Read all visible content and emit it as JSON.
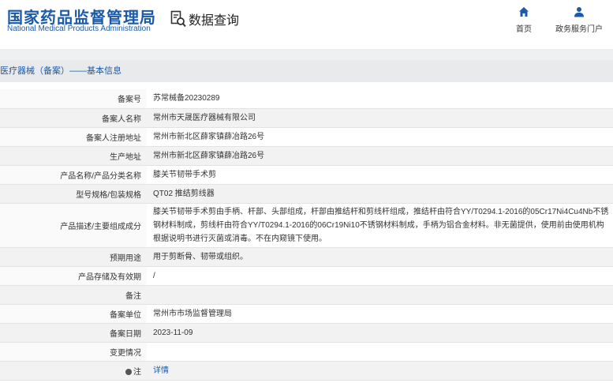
{
  "header": {
    "logo_cn": "国家药品监督管理局",
    "logo_en": "National Medical Products Administration",
    "query_label": "数据查询",
    "nav": [
      {
        "label": "首页",
        "icon": "home-icon"
      },
      {
        "label": "政务服务门户",
        "icon": "user-icon"
      }
    ],
    "brand_color": "#1c5aa8"
  },
  "breadcrumb": "医疗器械（备案）——基本信息",
  "detail": {
    "rows": [
      {
        "key": "备案号",
        "value": "苏常械备20230289"
      },
      {
        "key": "备案人名称",
        "value": "常州市天晟医疗器械有限公司"
      },
      {
        "key": "备案人注册地址",
        "value": "常州市新北区薛家镇薛冶路26号"
      },
      {
        "key": "生产地址",
        "value": "常州市新北区薛家镇薛冶路26号"
      },
      {
        "key": "产品名称/产品分类名称",
        "value": "膝关节韧带手术剪"
      },
      {
        "key": "型号规格/包装规格",
        "value": "QT02 推结剪线器"
      },
      {
        "key": "产品描述/主要组成成分",
        "value": "膝关节韧带手术剪由手柄、杆部、头部组成，杆部由推结杆和剪线杆组成，推结杆由符合YY/T0294.1-2016的05Cr17Ni4Cu4Nb不锈钢材料制成，剪线杆由符合YY/T0294.1-2016的06Cr19Ni10不锈钢材料制成，手柄为铝合金材料。非无菌提供，使用前由使用机构根据说明书进行灭菌或消毒。不在内窥镜下使用。"
      },
      {
        "key": "预期用途",
        "value": "用于剪断骨、韧带或组织。"
      },
      {
        "key": "产品存储及有效期",
        "value": "/"
      },
      {
        "key": "备注",
        "value": ""
      },
      {
        "key": "备案单位",
        "value": "常州市市场监督管理局"
      },
      {
        "key": "备案日期",
        "value": "2023-11-09"
      },
      {
        "key": "变更情况",
        "value": ""
      },
      {
        "key": "注",
        "value": "详情"
      }
    ]
  }
}
